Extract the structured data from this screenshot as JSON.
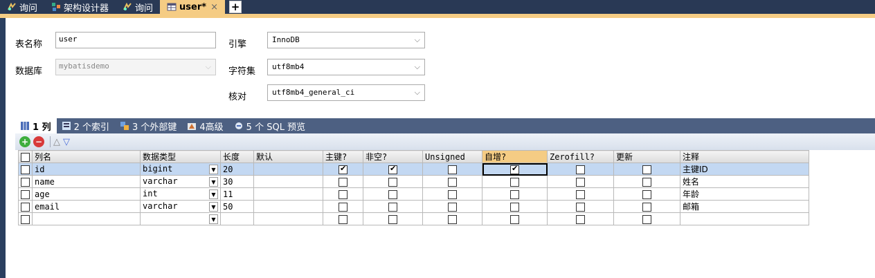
{
  "tabs": [
    {
      "label": "询问",
      "icon": "query-icon",
      "active": false
    },
    {
      "label": "架构设计器",
      "icon": "schema-designer-icon",
      "active": false
    },
    {
      "label": "询问",
      "icon": "query-icon",
      "active": false
    },
    {
      "label": "user*",
      "icon": "table-icon",
      "active": true,
      "close": "×"
    }
  ],
  "add_tab": "+",
  "form": {
    "table_name_label": "表名称",
    "table_name_value": "user",
    "database_label": "数据库",
    "database_value": "mybatisdemo",
    "engine_label": "引擎",
    "engine_value": "InnoDB",
    "charset_label": "字符集",
    "charset_value": "utf8mb4",
    "collation_label": "核对",
    "collation_value": "utf8mb4_general_ci"
  },
  "subtabs": [
    {
      "label": "1 列",
      "icon": "columns-icon",
      "active": true
    },
    {
      "label": "2 个索引",
      "icon": "index-icon",
      "active": false
    },
    {
      "label": "3 个外部键",
      "icon": "foreign-key-icon",
      "active": false
    },
    {
      "label": "4高级",
      "icon": "advanced-icon",
      "active": false
    },
    {
      "label": "5 个 SQL 预览",
      "icon": "sql-preview-icon",
      "active": false
    }
  ],
  "toolbar": {
    "add_icon": "+",
    "remove_icon": "−",
    "up_icon": "△",
    "down_icon": "▽"
  },
  "columns": [
    "列名",
    "数据类型",
    "长度",
    "默认",
    "主键?",
    "非空?",
    "Unsigned",
    "自增?",
    "Zerofill?",
    "更新",
    "注释"
  ],
  "rows": [
    {
      "name": "id",
      "type": "bigint",
      "length": "20",
      "default": "",
      "pk": true,
      "notnull": true,
      "unsigned": false,
      "autoinc": true,
      "zerofill": false,
      "update": false,
      "comment": "主键ID"
    },
    {
      "name": "name",
      "type": "varchar",
      "length": "30",
      "default": "",
      "pk": false,
      "notnull": false,
      "unsigned": false,
      "autoinc": false,
      "zerofill": false,
      "update": false,
      "comment": "姓名"
    },
    {
      "name": "age",
      "type": "int",
      "length": "11",
      "default": "",
      "pk": false,
      "notnull": false,
      "unsigned": false,
      "autoinc": false,
      "zerofill": false,
      "update": false,
      "comment": "年龄"
    },
    {
      "name": "email",
      "type": "varchar",
      "length": "50",
      "default": "",
      "pk": false,
      "notnull": false,
      "unsigned": false,
      "autoinc": false,
      "zerofill": false,
      "update": false,
      "comment": "邮箱"
    },
    {
      "name": "",
      "type": "",
      "length": "",
      "default": "",
      "pk": false,
      "notnull": false,
      "unsigned": false,
      "autoinc": false,
      "zerofill": false,
      "update": false,
      "comment": ""
    }
  ],
  "colors": {
    "accent": "#f5cc84",
    "tab_bg": "#293955",
    "selected_row": "#c3d8f2"
  }
}
